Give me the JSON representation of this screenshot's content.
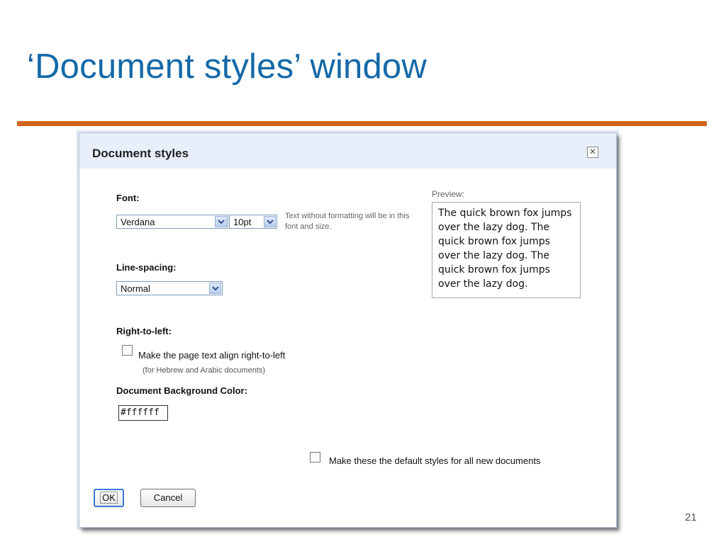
{
  "slide": {
    "title": "‘Document styles’ window",
    "page_number": "21",
    "accent_color": "#d0651e",
    "title_color": "#1469a8"
  },
  "dialog": {
    "title": "Document styles",
    "close_icon": "close-icon",
    "font": {
      "label": "Font:",
      "family_value": "Verdana",
      "size_value": "10pt",
      "hint": "Text without formatting will be in this font and size."
    },
    "line_spacing": {
      "label": "Line-spacing:",
      "value": "Normal"
    },
    "preview": {
      "label": "Preview:",
      "text": "The quick brown fox jumps over the lazy dog. The quick brown fox jumps over the lazy dog. The quick brown fox jumps over the lazy dog."
    },
    "rtl": {
      "label": "Right-to-left:",
      "checkbox_label": "Make the page text align right-to-left",
      "note": "(for Hebrew and Arabic documents)"
    },
    "background_color": {
      "label": "Document Background Color:",
      "value": "#ffffff"
    },
    "default_checkbox_label": "Make these the default styles for all new documents",
    "ok_label": "OK",
    "cancel_label": "Cancel"
  }
}
